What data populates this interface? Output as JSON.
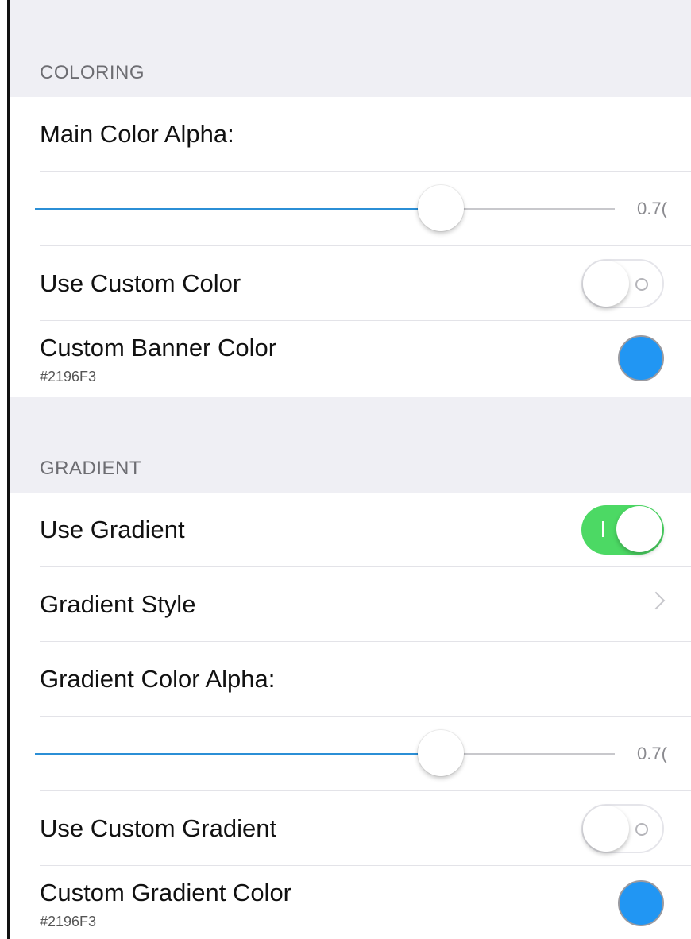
{
  "coloring": {
    "header": "COLORING",
    "main_color_alpha_label": "Main Color Alpha:",
    "main_alpha_slider": {
      "value": 0.7,
      "display": "0.7("
    },
    "use_custom_color": {
      "label": "Use Custom Color",
      "on": false
    },
    "custom_banner_color": {
      "label": "Custom Banner Color",
      "hex": "#2196F3",
      "swatch": "#2196F3"
    }
  },
  "gradient": {
    "header": "GRADIENT",
    "use_gradient": {
      "label": "Use Gradient",
      "on": true
    },
    "gradient_style": {
      "label": "Gradient Style"
    },
    "gradient_color_alpha_label": "Gradient Color Alpha:",
    "gradient_alpha_slider": {
      "value": 0.7,
      "display": "0.7("
    },
    "use_custom_gradient": {
      "label": "Use Custom Gradient",
      "on": false
    },
    "custom_gradient_color": {
      "label": "Custom Gradient Color",
      "hex": "#2196F3",
      "swatch": "#2196F3"
    }
  },
  "colors": {
    "toggle_on": "#4cd964",
    "slider_fill": "#2b8fd6",
    "group_background": "#efeff4"
  }
}
